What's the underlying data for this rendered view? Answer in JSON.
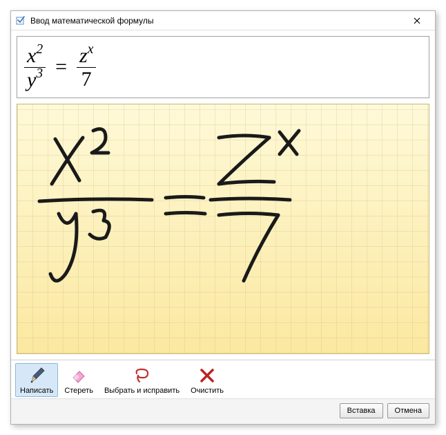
{
  "window": {
    "title": "Ввод математической формулы"
  },
  "formula": {
    "left_num_base": "x",
    "left_num_exp": "2",
    "left_den_base": "y",
    "left_den_exp": "3",
    "eq": "=",
    "right_num_base": "z",
    "right_num_exp": "x",
    "right_den": "7"
  },
  "tools": {
    "write": "Написать",
    "erase": "Стереть",
    "select": "Выбрать и исправить",
    "clear": "Очистить"
  },
  "buttons": {
    "insert": "Вставка",
    "cancel": "Отмена"
  }
}
